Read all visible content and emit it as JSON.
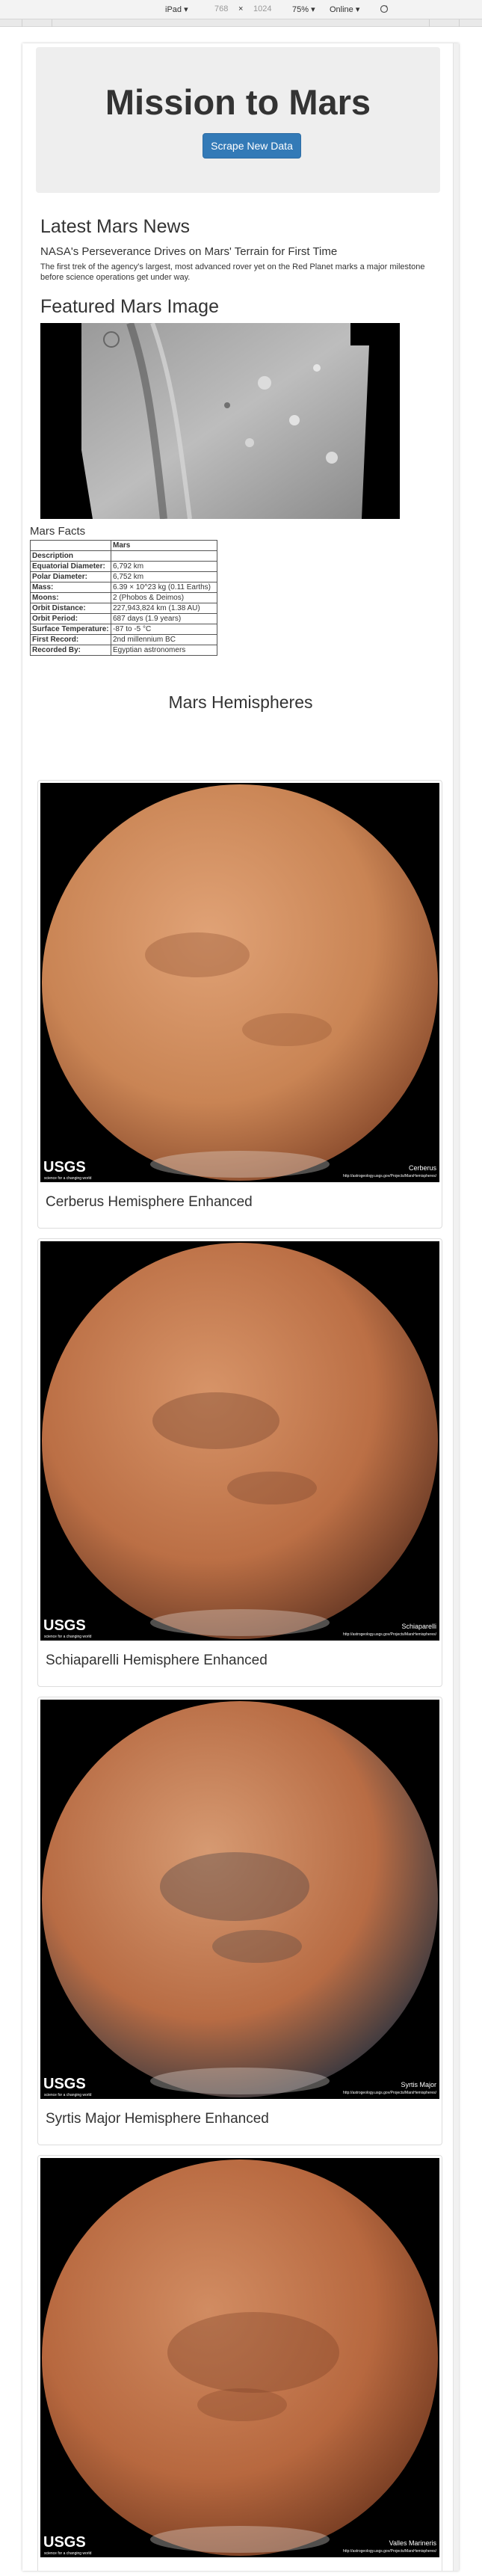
{
  "devtools": {
    "device": "iPad",
    "width": "768",
    "height": "1024",
    "zoom": "75%",
    "network": "Online"
  },
  "header": {
    "title": "Mission to Mars",
    "scrape_button": "Scrape New Data"
  },
  "news": {
    "heading": "Latest Mars News",
    "title": "NASA's Perseverance Drives on Mars' Terrain for First Time",
    "paragraph": "The first trek of the agency's largest, most advanced rover yet on the Red Planet marks a major milestone before science operations get under way."
  },
  "featured": {
    "heading": "Featured Mars Image"
  },
  "facts": {
    "label": "Mars Facts",
    "column": "Mars",
    "rows": [
      {
        "key": "Description",
        "value": ""
      },
      {
        "key": "Equatorial Diameter:",
        "value": "6,792 km"
      },
      {
        "key": "Polar Diameter:",
        "value": "6,752 km"
      },
      {
        "key": "Mass:",
        "value": "6.39 × 10^23 kg (0.11 Earths)"
      },
      {
        "key": "Moons:",
        "value": "2 (Phobos & Deimos)"
      },
      {
        "key": "Orbit Distance:",
        "value": "227,943,824 km (1.38 AU)"
      },
      {
        "key": "Orbit Period:",
        "value": "687 days (1.9 years)"
      },
      {
        "key": "Surface Temperature:",
        "value": "-87 to -5 °C"
      },
      {
        "key": "First Record:",
        "value": "2nd millennium BC"
      },
      {
        "key": "Recorded By:",
        "value": "Egyptian astronomers"
      }
    ]
  },
  "hemispheres": {
    "heading": "Mars Hemispheres",
    "usgs": "USGS",
    "usgs_tagline": "science for a changing world",
    "url": "http://astrogeology.usgs.gov/Projects/MarsHemispheres/",
    "items": [
      {
        "title": "Cerberus Hemisphere Enhanced",
        "image_label": "Cerberus"
      },
      {
        "title": "Schiaparelli Hemisphere Enhanced",
        "image_label": "Schiaparelli"
      },
      {
        "title": "Syrtis Major Hemisphere Enhanced",
        "image_label": "Syrtis Major"
      },
      {
        "title": "Valles Marineris Hemisphere Enhanced",
        "image_label": "Valles Marineris"
      }
    ]
  },
  "colors": {
    "jumbotron": "#eeeeee",
    "button": "#337ab7",
    "mars_base": "#c4784e"
  }
}
